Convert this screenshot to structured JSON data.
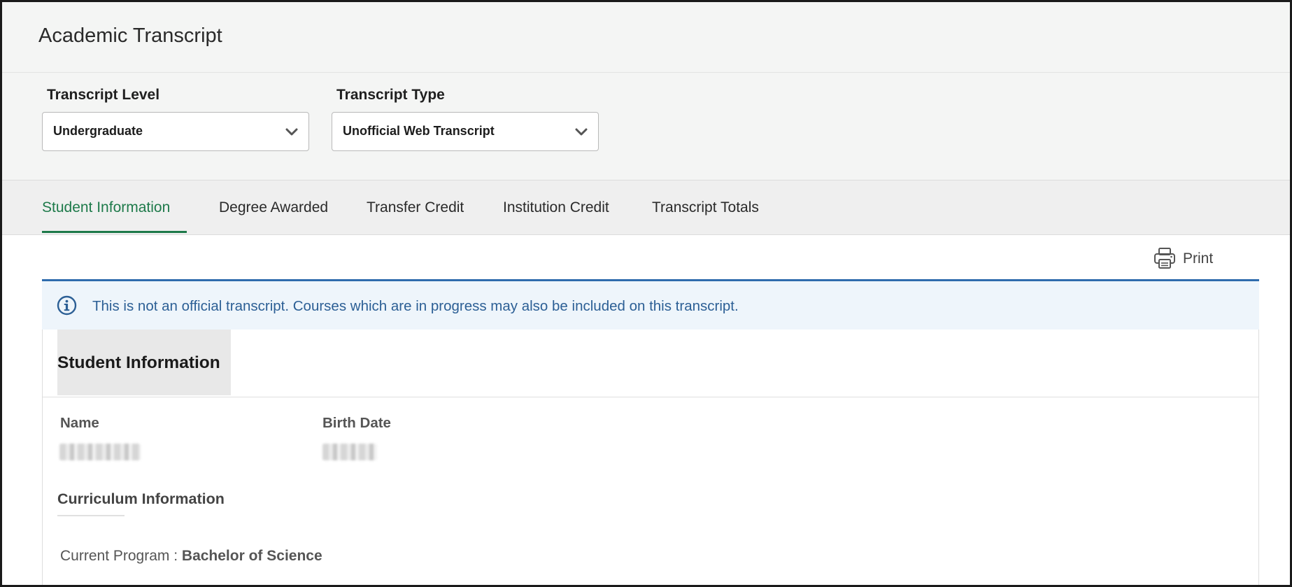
{
  "page": {
    "title": "Academic Transcript"
  },
  "filters": {
    "level": {
      "label": "Transcript Level",
      "value": "Undergraduate"
    },
    "type": {
      "label": "Transcript Type",
      "value": "Unofficial Web Transcript"
    }
  },
  "tabs": [
    {
      "label": "Student Information",
      "active": true
    },
    {
      "label": "Degree Awarded",
      "active": false
    },
    {
      "label": "Transfer Credit",
      "active": false
    },
    {
      "label": "Institution Credit",
      "active": false
    },
    {
      "label": "Transcript Totals",
      "active": false
    }
  ],
  "toolbar": {
    "print_label": "Print",
    "print_icon": "printer-icon"
  },
  "notice": {
    "icon": "info-icon",
    "text": "This is not an official transcript. Courses which are in progress may also be included on this transcript."
  },
  "student_info": {
    "section_title": "Student Information",
    "name_label": "Name",
    "birth_date_label": "Birth Date",
    "curriculum_heading": "Curriculum Information",
    "current_program_label": "Current Program :",
    "current_program_value": "Bachelor of Science"
  },
  "colors": {
    "accent_green": "#1e7a4a",
    "info_blue": "#2c5f95",
    "border_blue": "#2f6cad",
    "notice_bg": "#eef5fb"
  }
}
